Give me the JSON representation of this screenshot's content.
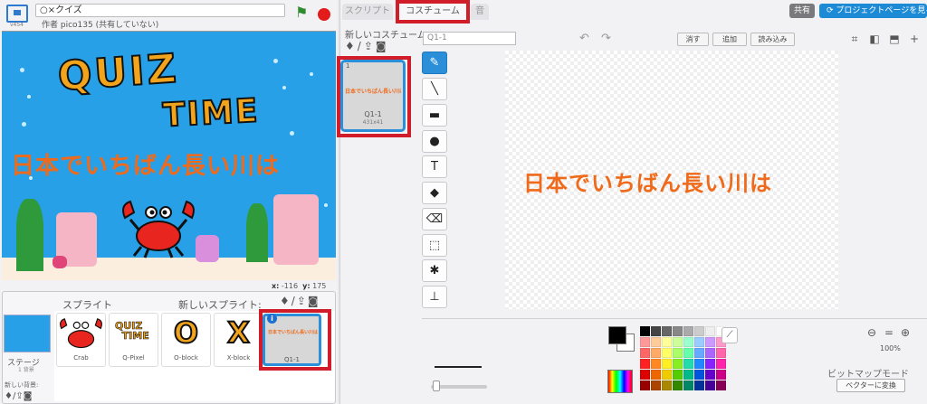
{
  "stage_header": {
    "version": "v454",
    "title": "○×クイズ",
    "author": "作者 pico135 (共有していない)"
  },
  "stage": {
    "quiz_title": "QUIZ",
    "time_title": "TIME",
    "question": "日本でいちばん長い川は",
    "coords_x_label": "x:",
    "coords_x": "-116",
    "coords_y_label": "y:",
    "coords_y": "175"
  },
  "sprite_panel": {
    "title": "スプライト",
    "new_sprite_label": "新しいスプライト:",
    "stage_label": "ステージ",
    "stage_bg_count": "1 背景",
    "new_bg_label": "新しい背景:",
    "sprites": [
      {
        "name": "Crab"
      },
      {
        "name": "Q-Pixel"
      },
      {
        "name": "O-block"
      },
      {
        "name": "X-block"
      },
      {
        "name": "Q1-1"
      }
    ],
    "thumb_quiz": "QUIZ",
    "thumb_time": "TIME",
    "thumb_o": "O",
    "thumb_x": "X",
    "thumb_q1_text": "日本でいちばん長い川は"
  },
  "tabs": {
    "scripts": "スクリプト",
    "costumes": "コスチューム",
    "sounds": "音"
  },
  "top_right": {
    "share": "共有",
    "project_page": "プロジェクトページを見る"
  },
  "costume_panel": {
    "new_costume_label": "新しいコスチューム:",
    "costume_index": "1",
    "costume_name": "Q1-1",
    "costume_size": "431x41",
    "name_input_value": "Q1-1",
    "clear": "消す",
    "add": "追加",
    "import": "読み込み"
  },
  "canvas": {
    "text": "日本でいちばん長い川は"
  },
  "bottom": {
    "zoom_level": "100%",
    "bitmap_mode": "ビットマップモード",
    "convert_vector": "ベクターに変換"
  },
  "palette_colors": [
    "#000000",
    "#444444",
    "#666666",
    "#888888",
    "#aaaaaa",
    "#cccccc",
    "#eeeeee",
    "#ffffff",
    "#ff9999",
    "#ffcc99",
    "#ffff99",
    "#ccff99",
    "#99ffcc",
    "#99ccff",
    "#cc99ff",
    "#ff99cc",
    "#ff6666",
    "#ffaa66",
    "#ffff66",
    "#aaff66",
    "#66ffaa",
    "#66aaff",
    "#aa66ff",
    "#ff66aa",
    "#ff2222",
    "#ff8822",
    "#ffee22",
    "#88ee22",
    "#22ddaa",
    "#2288ff",
    "#8822ff",
    "#ff22aa",
    "#dd0000",
    "#ee6600",
    "#eecc00",
    "#55cc00",
    "#00bb88",
    "#0055dd",
    "#6600cc",
    "#cc0088",
    "#990000",
    "#aa4400",
    "#aa8800",
    "#338800",
    "#008866",
    "#003399",
    "#440099",
    "#880055"
  ]
}
